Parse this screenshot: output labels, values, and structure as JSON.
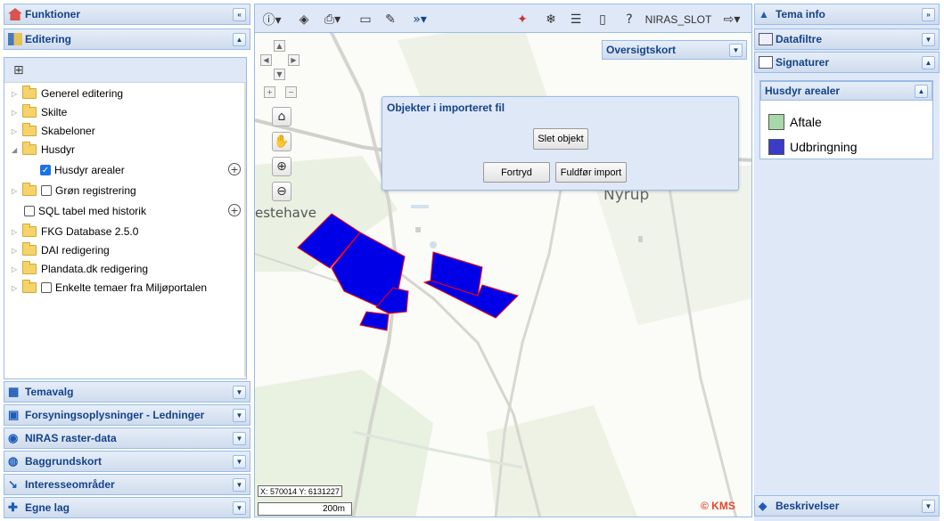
{
  "left": {
    "funktioner": "Funktioner",
    "editering": "Editering",
    "tree": [
      {
        "label": "Generel editering",
        "folder": true,
        "check": false
      },
      {
        "label": "Skilte",
        "folder": true,
        "check": false
      },
      {
        "label": "Skabeloner",
        "folder": true,
        "check": false
      },
      {
        "label": "Husdyr",
        "folder": true,
        "check": false,
        "open": true
      },
      {
        "label": "Husdyr arealer",
        "folder": false,
        "check": true,
        "checked": true
      },
      {
        "label": "Grøn registrering",
        "folder": true,
        "check": true,
        "checked": false
      },
      {
        "label": "SQL tabel med historik",
        "folder": false,
        "check": true,
        "checked": false
      },
      {
        "label": "FKG Database 2.5.0",
        "folder": true,
        "check": false
      },
      {
        "label": "DAI redigering",
        "folder": true,
        "check": false
      },
      {
        "label": "Plandata.dk redigering",
        "folder": true,
        "check": false
      },
      {
        "label": "Enkelte temaer fra Miljøportalen",
        "folder": true,
        "check": true,
        "checked": false
      }
    ],
    "panels": [
      "Temavalg",
      "Forsyningsoplysninger - Ledninger",
      "NIRAS raster-data",
      "Baggrundskort",
      "Interesseområder",
      "Egne lag"
    ]
  },
  "toolbar": {
    "user": "NIRAS_SLOT",
    "info_icon": "info-icon",
    "layers_icon": "layers-icon"
  },
  "map": {
    "oversigt": "Oversigtskort",
    "dialog_title": "Objekter i importeret fil",
    "slet": "Slet objekt",
    "fortryd": "Fortryd",
    "fuldfor": "Fuldfør import",
    "place_nyrup": "Nyrup",
    "place_estehave": "estehave",
    "coords": "X: 570014 Y: 6131227",
    "scale": "200m",
    "copyright": "© KMS",
    "colors": {
      "fill": "#0000e6",
      "stroke": "#ff0000"
    }
  },
  "right": {
    "tema_info": "Tema info",
    "datafiltre": "Datafiltre",
    "signaturer": "Signaturer",
    "husdyr": "Husdyr arealer",
    "legend": [
      {
        "label": "Aftale",
        "color": "#a8d8a8"
      },
      {
        "label": "Udbringning",
        "color": "#3b3bc8"
      }
    ],
    "beskrivelser": "Beskrivelser"
  }
}
